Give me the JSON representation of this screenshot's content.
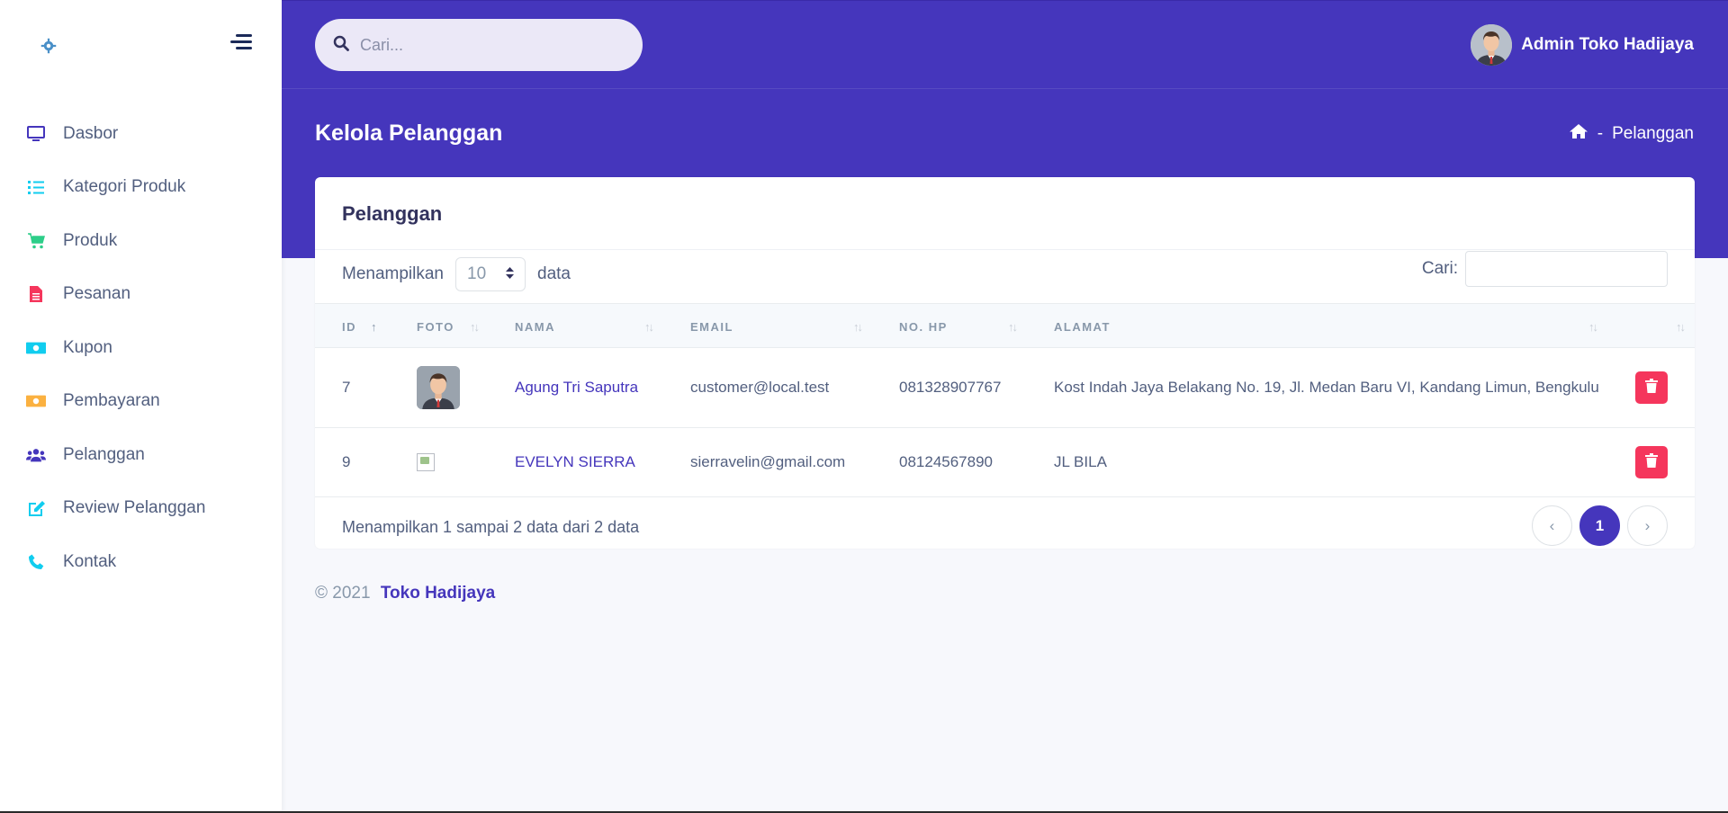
{
  "sidebar": {
    "logo_icon": "gear-icon",
    "toggle_icon": "menu-toggle-icon",
    "items": [
      {
        "label": "Dasbor",
        "icon": "monitor-icon",
        "color": "#4536bc"
      },
      {
        "label": "Kategori Produk",
        "icon": "list-icon",
        "color": "#11cdef"
      },
      {
        "label": "Produk",
        "icon": "cart-icon",
        "color": "#2dce89"
      },
      {
        "label": "Pesanan",
        "icon": "document-icon",
        "color": "#f5365c"
      },
      {
        "label": "Kupon",
        "icon": "money-icon",
        "color": "#11cdef"
      },
      {
        "label": "Pembayaran",
        "icon": "money-icon",
        "color": "#fbb140"
      },
      {
        "label": "Pelanggan",
        "icon": "users-icon",
        "color": "#4536bc"
      },
      {
        "label": "Review Pelanggan",
        "icon": "edit-icon",
        "color": "#11cdef"
      },
      {
        "label": "Kontak",
        "icon": "phone-icon",
        "color": "#11cdef"
      }
    ]
  },
  "header": {
    "search_placeholder": "Cari...",
    "user_name": "Admin Toko Hadijaya",
    "page_title": "Kelola Pelanggan",
    "breadcrumb_sep": "-",
    "breadcrumb_current": "Pelanggan"
  },
  "card": {
    "title": "Pelanggan",
    "length_prefix": "Menampilkan",
    "length_value": "10",
    "length_suffix": "data",
    "search_label": "Cari:",
    "columns": [
      "ID",
      "FOTO",
      "NAMA",
      "EMAIL",
      "NO. HP",
      "ALAMAT"
    ],
    "rows": [
      {
        "id": "7",
        "photo": "avatar",
        "name": "Agung Tri Saputra",
        "email": "customer@local.test",
        "phone": "081328907767",
        "address": "Kost Indah Jaya Belakang No. 19, Jl. Medan Baru VI, Kandang Limun, Bengkulu"
      },
      {
        "id": "9",
        "photo": "broken-image",
        "name": "EVELYN SIERRA",
        "email": "sierravelin@gmail.com",
        "phone": "08124567890",
        "address": "JL BILA"
      }
    ],
    "info": "Menampilkan 1 sampai 2 data dari 2 data",
    "pager": {
      "prev": "‹",
      "current": "1",
      "next": "›"
    }
  },
  "footer": {
    "copyright": "© 2021",
    "brand": "Toko Hadijaya"
  },
  "colors": {
    "primary": "#4536bc",
    "danger": "#f5365c",
    "info": "#11cdef",
    "success": "#2dce89",
    "warning": "#fbb140"
  }
}
